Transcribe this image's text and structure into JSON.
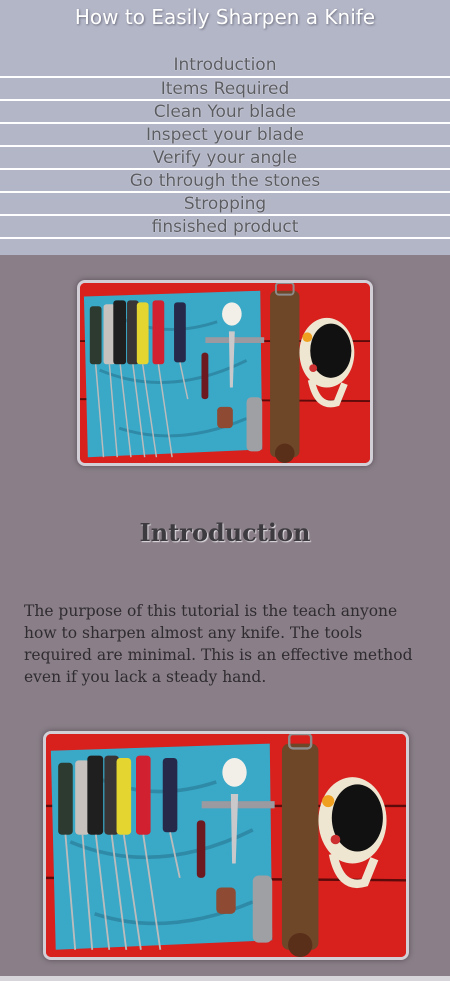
{
  "header": {
    "title": "How to Easily Sharpen a Knife",
    "nav": [
      "Introduction",
      "Items Required",
      "Clean Your blade",
      "Inspect your blade",
      "Verify your angle",
      "Go through the stones",
      "Stropping",
      "finsished product"
    ]
  },
  "main": {
    "heading": "Introduction",
    "paragraph": "The purpose of this tutorial is the teach anyone how to sharpen almost any knife. The tools required are minimal. This is an effective method even if you lack a steady hand."
  },
  "colors": {
    "header_bg": "#b3b6c7",
    "page_bg": "#8a7f88",
    "nav_text": "#5b5c62"
  }
}
